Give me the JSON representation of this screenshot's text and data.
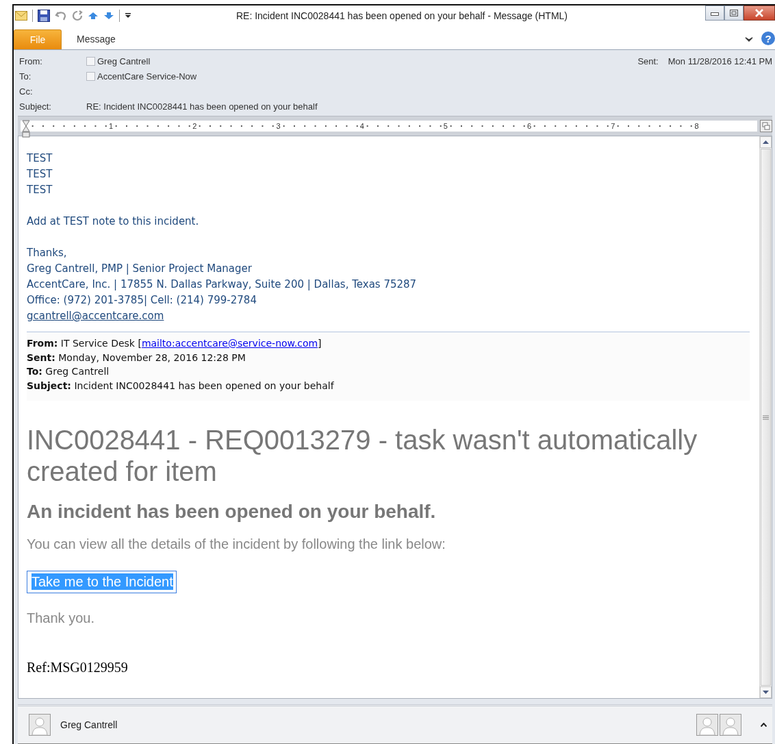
{
  "window": {
    "title": "RE: Incident INC0028441 has been opened on your behalf  -  Message (HTML)"
  },
  "ribbon": {
    "file_button": "File",
    "tabs": [
      "Message"
    ],
    "help": "?"
  },
  "header": {
    "fields": [
      {
        "label": "From:",
        "value": "Greg Cantrell",
        "kind": "person"
      },
      {
        "label": "To:",
        "value": "AccentCare Service-Now",
        "kind": "person"
      },
      {
        "label": "Cc:",
        "kind": "empty"
      },
      {
        "label": "Subject:",
        "value": "RE: Incident INC0028441 has been opened on your behalf",
        "kind": "text"
      }
    ],
    "sent": {
      "label": "Sent:",
      "value": "Mon 11/28/2016 12:41 PM"
    }
  },
  "ruler": {
    "numbers": [
      "1",
      "2",
      "3",
      "4",
      "5",
      "6",
      "7",
      "8"
    ]
  },
  "reply": {
    "lines": [
      "TEST",
      "TEST",
      "TEST"
    ],
    "note": "Add at TEST note to this incident.",
    "signature": [
      "Thanks,",
      "Greg Cantrell, PMP | Senior Project Manager",
      "AccentCare, Inc. | 17855 N. Dallas Parkway, Suite 200 | Dallas, Texas  75287",
      "Office:  (972) 201-3785| Cell:  (214) 799-2784"
    ],
    "email": "gcantrell@accentcare.com"
  },
  "quoted_header": [
    {
      "text": "**From:** IT Service Desk [",
      "link": "mailto:accentcare@service-now.com",
      "after": "]"
    },
    {
      "text": "**Sent:** Monday, November 28, 2016 12:28 PM"
    },
    {
      "text": "**To:** Greg Cantrell"
    },
    {
      "text": "**Subject:** Incident INC0028441 has been opened on your behalf"
    }
  ],
  "incident": {
    "title": "INC0028441 - REQ0013279 - task wasn't automatically created for item",
    "subtitle": "An incident has been opened on your behalf.",
    "text": "You can view all the details of the incident by following the link below:",
    "link": {
      "label": "Take me to the Incident",
      "selected": true
    },
    "thanks": "Thank you.",
    "ref": "Ref:MSG0129959"
  },
  "people_pane": {
    "name": "Greg Cantrell"
  }
}
